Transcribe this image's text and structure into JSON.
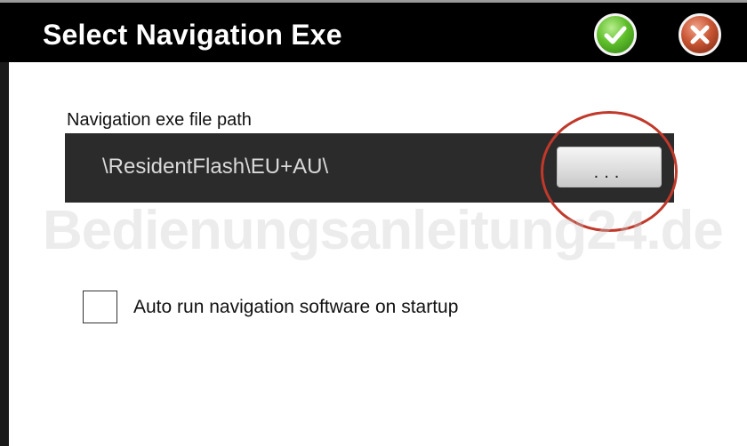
{
  "window": {
    "title": "Select Navigation Exe",
    "confirm_icon": "check-icon",
    "close_icon": "close-icon",
    "colors": {
      "titlebar": "#000000",
      "confirm": "#5fbf2a",
      "close": "#c85634",
      "highlight": "#c0392b"
    }
  },
  "exe_path": {
    "label": "Navigation exe file path",
    "value": "\\ResidentFlash\\EU+AU\\",
    "browse_label": "..."
  },
  "autorun": {
    "label": "Auto run navigation software on startup",
    "checked": false
  },
  "watermark": {
    "text": "Bedienungsanleitung24.de"
  }
}
